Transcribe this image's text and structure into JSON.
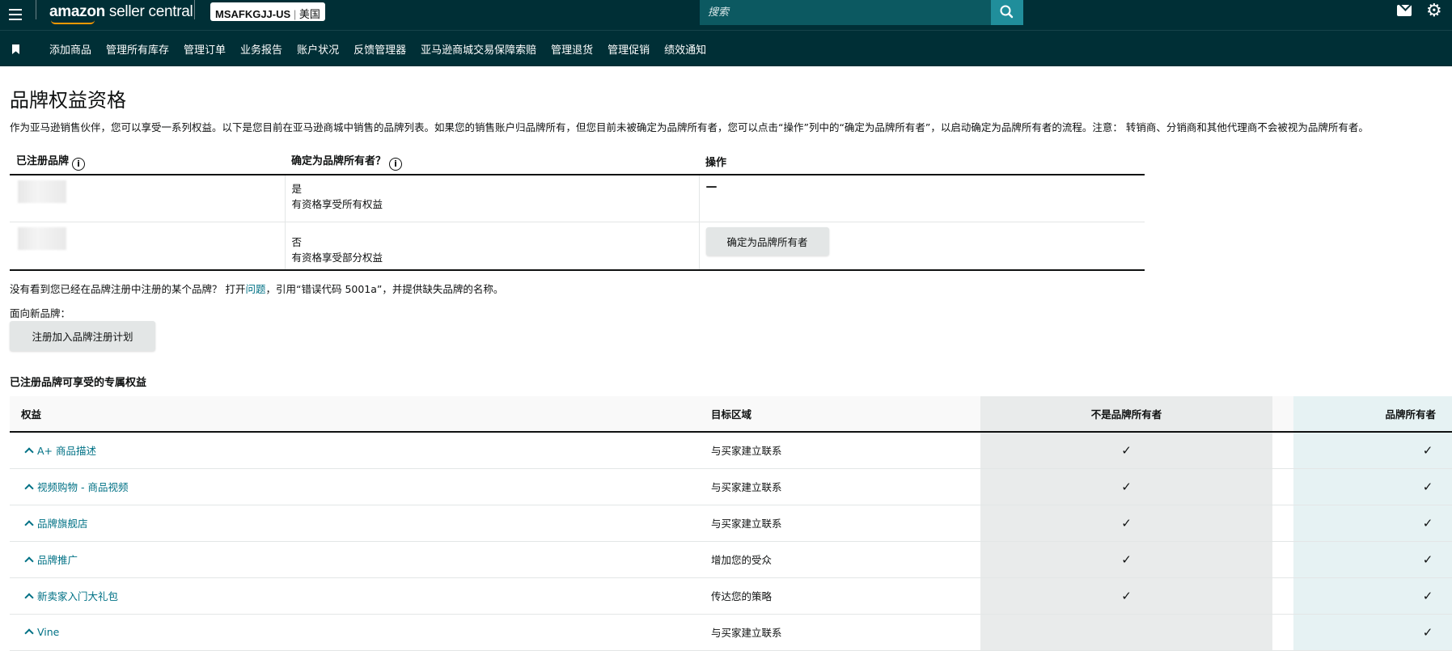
{
  "header": {
    "logo_text_bold": "amazon",
    "logo_text_light": " seller central",
    "account_id": "MSAFKGJJ-US",
    "marketplace": "美国",
    "search_placeholder": "搜索",
    "icons": [
      "hamburger-menu-icon",
      "search-icon",
      "mail-icon",
      "gear-icon"
    ]
  },
  "nav": {
    "items": [
      "添加商品",
      "管理所有库存",
      "管理订单",
      "业务报告",
      "账户状况",
      "反馈管理器",
      "亚马逊商城交易保障索赔",
      "管理退货",
      "管理促销",
      "绩效通知"
    ]
  },
  "page": {
    "title": "品牌权益资格",
    "intro": "作为亚马逊销售伙伴，您可以享受一系列权益。以下是您目前在亚马逊商城中销售的品牌列表。如果您的销售账户归品牌所有，但您目前未被确定为品牌所有者，您可以点击“操作”列中的“确定为品牌所有者”，以启动确定为品牌所有者的流程。注意： 转销商、分销商和其他代理商不会被视为品牌所有者。"
  },
  "brand_table": {
    "headers": [
      "已注册品牌",
      "确定为品牌所有者？",
      "操作"
    ],
    "rows": [
      {
        "owner": "是",
        "eligibility": "有资格享受所有权益",
        "action": "—"
      },
      {
        "owner": "否",
        "eligibility": "有资格享受部分权益",
        "action": "确定为品牌所有者"
      }
    ]
  },
  "missing_brand": {
    "text_before": "没有看到您已经在品牌注册中注册的某个品牌？ 打开",
    "link": "问题",
    "text_after": "，引用“错误代码 5001a”，并提供缺失品牌的名称。"
  },
  "new_brand": {
    "label": "面向新品牌：",
    "button": "注册加入品牌注册计划"
  },
  "benefits": {
    "title": "已注册品牌可享受的专属权益",
    "headers": [
      "权益",
      "目标区域",
      "不是品牌所有者",
      "品牌所有者"
    ],
    "rows": [
      {
        "name": "A+ 商品描述",
        "area": "与买家建立联系",
        "non_owner": "✓",
        "owner": "✓"
      },
      {
        "name": "视频购物 - 商品视频",
        "area": "与买家建立联系",
        "non_owner": "✓",
        "owner": "✓"
      },
      {
        "name": "品牌旗舰店",
        "area": "与买家建立联系",
        "non_owner": "✓",
        "owner": "✓"
      },
      {
        "name": "品牌推广",
        "area": "增加您的受众",
        "non_owner": "✓",
        "owner": "✓"
      },
      {
        "name": "新卖家入门大礼包",
        "area": "传达您的策略",
        "non_owner": "✓",
        "owner": "✓"
      },
      {
        "name": "Vine",
        "area": "与买家建立联系",
        "non_owner": "",
        "owner": "✓"
      }
    ]
  }
}
